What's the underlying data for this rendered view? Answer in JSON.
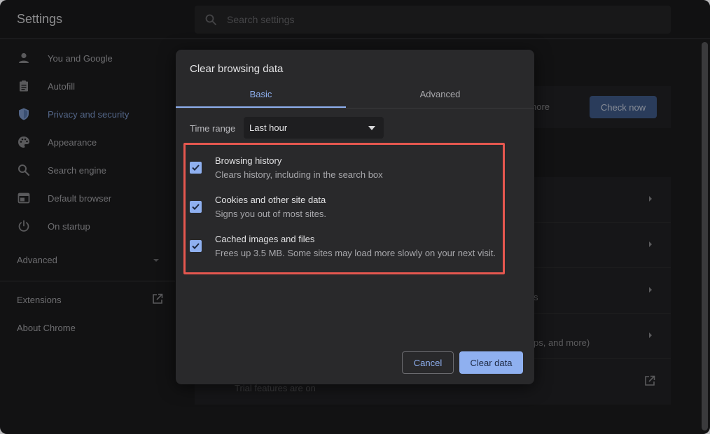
{
  "app": {
    "title": "Settings"
  },
  "search": {
    "placeholder": "Search settings"
  },
  "sidebar": {
    "items": [
      {
        "label": "You and Google",
        "icon": "person-icon"
      },
      {
        "label": "Autofill",
        "icon": "clipboard-icon"
      },
      {
        "label": "Privacy and security",
        "icon": "shield-icon",
        "active": true
      },
      {
        "label": "Appearance",
        "icon": "palette-icon"
      },
      {
        "label": "Search engine",
        "icon": "search-icon"
      },
      {
        "label": "Default browser",
        "icon": "browser-icon"
      },
      {
        "label": "On startup",
        "icon": "power-icon"
      }
    ],
    "advanced_label": "Advanced",
    "extensions_label": "Extensions",
    "about_label": "About Chrome"
  },
  "background": {
    "safety_check_partial": "nore",
    "check_now_label": "Check now",
    "row3_partial": "s",
    "row4_partial": "ps, and more)",
    "trial_text": "Trial features are on"
  },
  "dialog": {
    "title": "Clear browsing data",
    "tabs": [
      {
        "label": "Basic",
        "active": true
      },
      {
        "label": "Advanced",
        "active": false
      }
    ],
    "time_range_label": "Time range",
    "time_range_value": "Last hour",
    "options": [
      {
        "title": "Browsing history",
        "description": "Clears history, including in the search box",
        "checked": true
      },
      {
        "title": "Cookies and other site data",
        "description": "Signs you out of most sites.",
        "checked": true
      },
      {
        "title": "Cached images and files",
        "description": "Frees up 3.5 MB. Some sites may load more slowly on your next visit.",
        "checked": true
      }
    ],
    "cancel_label": "Cancel",
    "clear_label": "Clear data"
  },
  "colors": {
    "accent": "#8fb0f0",
    "highlight": "#e5574f",
    "dialog_bg": "#29292b",
    "window_bg": "#1c1c1e"
  }
}
